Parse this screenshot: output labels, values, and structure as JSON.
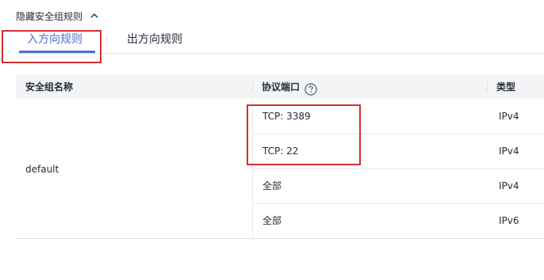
{
  "section": {
    "toggle_label": "隐藏安全组规则",
    "toggle_icon": "chevron-up-icon"
  },
  "tabs": [
    {
      "label": "入方向规则",
      "active": true
    },
    {
      "label": "出方向规则",
      "active": false
    }
  ],
  "table": {
    "columns": [
      "安全组名称",
      "协议端口",
      "类型"
    ],
    "help_icon": "question-circle-icon",
    "group_name": "default",
    "rows": [
      {
        "protocol_port": "TCP: 3389",
        "type": "IPv4"
      },
      {
        "protocol_port": "TCP: 22",
        "type": "IPv4"
      },
      {
        "protocol_port": "全部",
        "type": "IPv4"
      },
      {
        "protocol_port": "全部",
        "type": "IPv6"
      }
    ]
  },
  "colors": {
    "accent": "#526ecc",
    "highlight": "#d32f2f",
    "header_bg": "#f3f4f6"
  }
}
